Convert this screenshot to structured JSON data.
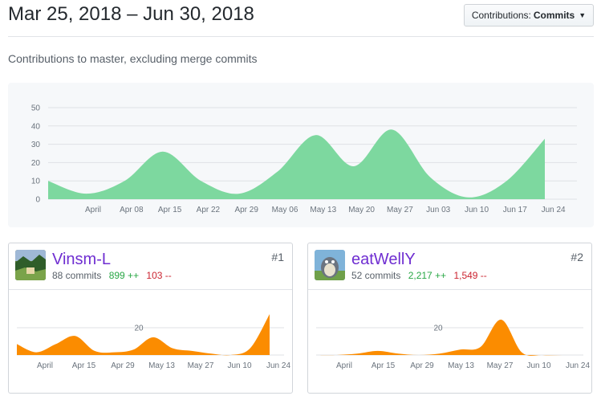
{
  "header": {
    "date_range": "Mar 25, 2018 – Jun 30, 2018",
    "contributions_prefix": "Contributions:",
    "contributions_value": "Commits"
  },
  "subtitle": "Contributions to master, excluding merge commits",
  "chart_data": [
    {
      "type": "area",
      "title": "",
      "x": [
        "Mar 25",
        "Apr 01",
        "Apr 08",
        "Apr 15",
        "Apr 22",
        "Apr 29",
        "May 06",
        "May 13",
        "May 20",
        "May 27",
        "Jun 03",
        "Jun 10",
        "Jun 17",
        "Jun 24"
      ],
      "series": [
        {
          "values": [
            10,
            3,
            10,
            26,
            10,
            3,
            15,
            35,
            18,
            38,
            12,
            1,
            10,
            33
          ]
        }
      ],
      "x_tick_labels": [
        "April",
        "Apr 08",
        "Apr 15",
        "Apr 22",
        "Apr 29",
        "May 06",
        "May 13",
        "May 20",
        "May 27",
        "Jun 03",
        "Jun 10",
        "Jun 17",
        "Jun 24"
      ],
      "y_ticks": [
        "0",
        "10",
        "20",
        "30",
        "40",
        "50"
      ],
      "ylim": [
        0,
        50
      ],
      "grid": true,
      "color": "#7dd89f"
    },
    {
      "type": "area",
      "x": [
        "Mar 25",
        "Apr 01",
        "Apr 08",
        "Apr 15",
        "Apr 22",
        "Apr 29",
        "May 06",
        "May 13",
        "May 20",
        "May 27",
        "Jun 03",
        "Jun 10",
        "Jun 17",
        "Jun 24"
      ],
      "series": [
        {
          "values": [
            8,
            2,
            8,
            14,
            3,
            2,
            4,
            13,
            5,
            3,
            1,
            0,
            5,
            30
          ]
        }
      ],
      "x_tick_labels": [
        "April",
        "Apr 15",
        "Apr 29",
        "May 13",
        "May 27",
        "Jun 10",
        "Jun 24"
      ],
      "y_ticks": [
        "20"
      ],
      "ylim": [
        0,
        33
      ],
      "color": "#fb8c00"
    },
    {
      "type": "area",
      "x": [
        "Mar 25",
        "Apr 01",
        "Apr 08",
        "Apr 15",
        "Apr 22",
        "Apr 29",
        "May 06",
        "May 13",
        "May 20",
        "May 27",
        "Jun 03",
        "Jun 10",
        "Jun 17",
        "Jun 24"
      ],
      "series": [
        {
          "values": [
            0,
            0,
            1,
            3,
            1,
            0,
            1,
            4,
            6,
            26,
            2,
            0,
            0,
            0
          ]
        }
      ],
      "x_tick_labels": [
        "April",
        "Apr 15",
        "Apr 29",
        "May 13",
        "May 27",
        "Jun 10",
        "Jun 24"
      ],
      "y_ticks": [
        "20"
      ],
      "ylim": [
        0,
        33
      ],
      "color": "#fb8c00"
    }
  ],
  "contributors": [
    {
      "name": "Vinsm-L",
      "commits": "88 commits",
      "additions": "899 ++",
      "deletions": "103 --",
      "rank": "#1"
    },
    {
      "name": "eatWellY",
      "commits": "52 commits",
      "additions": "2,217 ++",
      "deletions": "1,549 --",
      "rank": "#2"
    }
  ],
  "colors": {
    "main_area": "#7dd89f",
    "user_area": "#fb8c00",
    "link": "#6f2ed1",
    "add": "#28a745",
    "del": "#cb2431"
  }
}
